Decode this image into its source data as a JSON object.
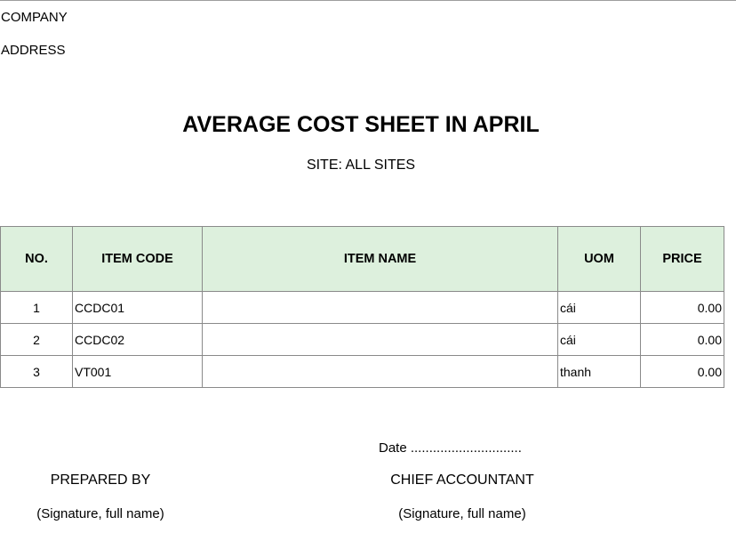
{
  "header": {
    "company": "COMPANY",
    "address": "ADDRESS"
  },
  "title": "AVERAGE COST SHEET IN APRIL",
  "site": "SITE: ALL SITES",
  "table": {
    "columns": [
      "NO.",
      "ITEM CODE",
      "ITEM NAME",
      "UOM",
      "PRICE"
    ],
    "rows": [
      {
        "no": "1",
        "item_code": "CCDC01",
        "item_name": "",
        "uom": "cái",
        "price": "0.00"
      },
      {
        "no": "2",
        "item_code": "CCDC02",
        "item_name": "",
        "uom": "cái",
        "price": "0.00"
      },
      {
        "no": "3",
        "item_code": "VT001",
        "item_name": "",
        "uom": "thanh",
        "price": "0.00"
      }
    ]
  },
  "footer": {
    "date": "Date ..............................",
    "prepared_by": "PREPARED BY",
    "prepared_sig": "(Signature, full name)",
    "chief_accountant": "CHIEF ACCOUNTANT",
    "chief_sig": "(Signature, full name)"
  }
}
